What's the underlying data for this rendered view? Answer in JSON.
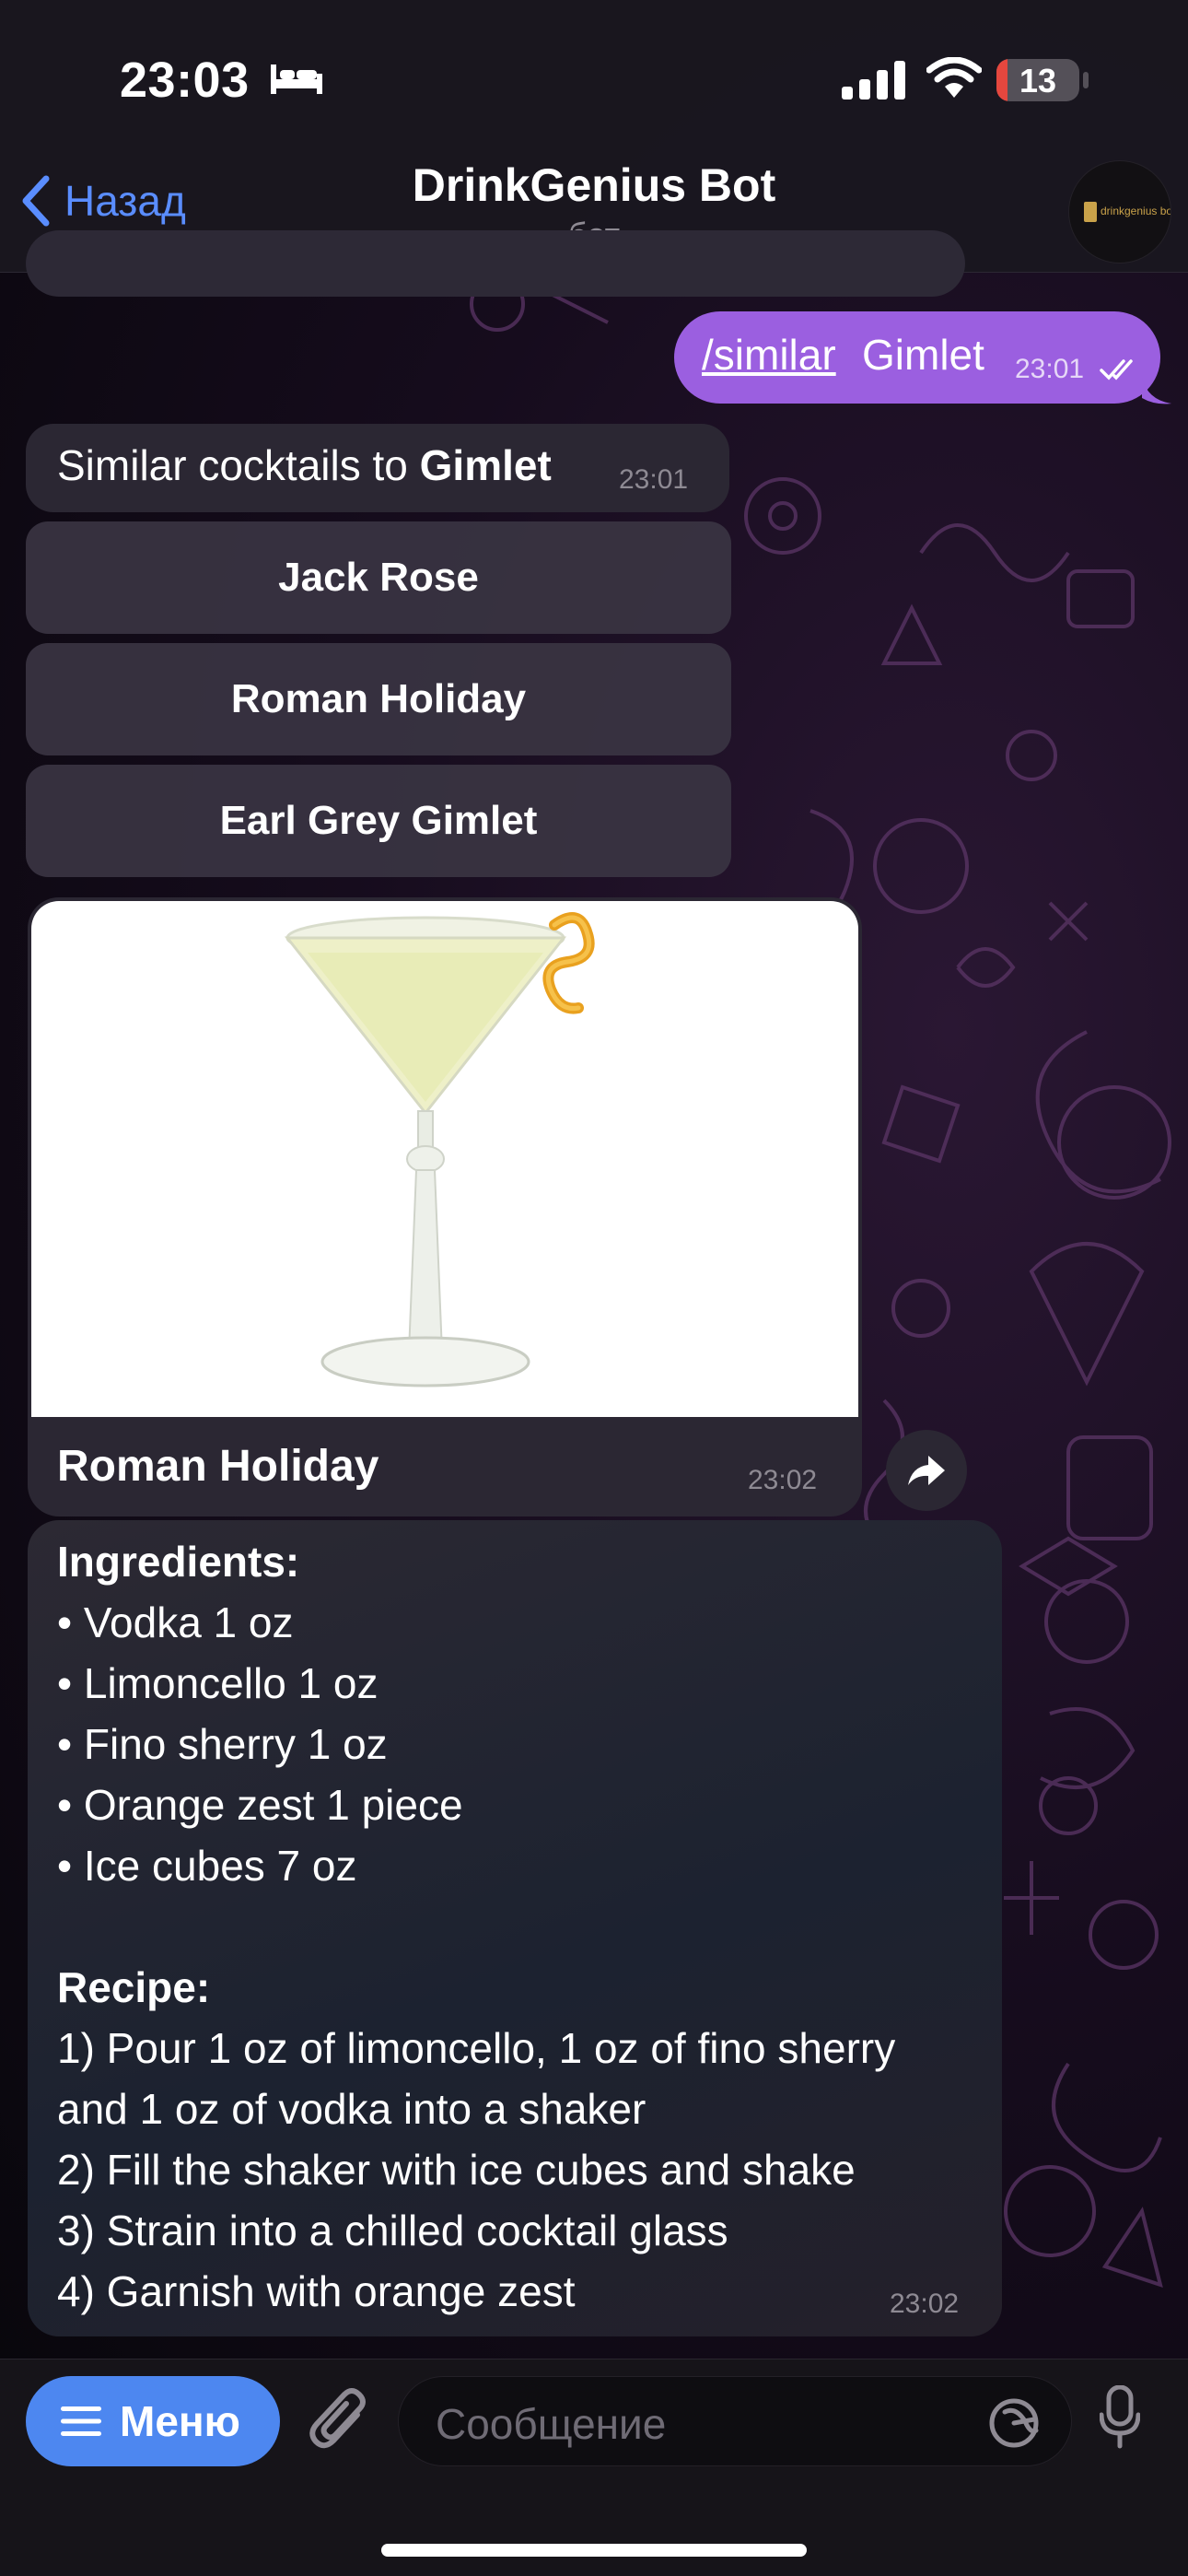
{
  "status_bar": {
    "time": "23:03",
    "battery": "13",
    "battery_fraction": 0.13,
    "focus_icon": "bed-icon",
    "signal_icon": "cellular-signal-icon",
    "wifi_icon": "wifi-icon"
  },
  "header": {
    "back_label": "Назад",
    "title": "DrinkGenius Bot",
    "subtitle": "бот",
    "avatar_text": "drinkgenius bot"
  },
  "messages": {
    "outgoing": {
      "command": "/similar",
      "text": "Gimlet",
      "time": "23:01",
      "read_icon": "double-check-icon"
    },
    "similar": {
      "prefix": "Similar cocktails to",
      "cocktail": "Gimlet",
      "time": "23:01",
      "buttons": [
        "Jack Rose",
        "Roman Holiday",
        "Earl Grey Gimlet"
      ]
    },
    "photo": {
      "caption": "Roman Holiday",
      "time": "23:02",
      "share_icon": "share-arrow-icon"
    },
    "recipe": {
      "ingredients_heading": "Ingredients:",
      "ingredients": [
        "• Vodka  1 oz",
        "• Limoncello  1 oz",
        "• Fino sherry  1 oz",
        "• Orange zest  1 piece",
        "• Ice cubes  7 oz"
      ],
      "recipe_heading": "Recipe:",
      "steps": [
        "1) Pour 1 oz of limoncello, 1 oz of fino sherry",
        "and 1 oz of vodka into a shaker",
        "2) Fill the shaker with ice cubes and shake",
        "3) Strain into a chilled cocktail glass",
        "4) Garnish with orange zest"
      ],
      "time": "23:02"
    }
  },
  "input_bar": {
    "menu_label": "Меню",
    "placeholder": "Сообщение",
    "attach_icon": "paperclip-icon",
    "sticker_icon": "sticker-icon",
    "mic_icon": "microphone-icon"
  },
  "colors": {
    "accent_blue": "#5a8dff",
    "outgoing_bubble": "#9b5fe0",
    "incoming_bubble": "#2b2733",
    "menu_button": "#4d87f0"
  }
}
